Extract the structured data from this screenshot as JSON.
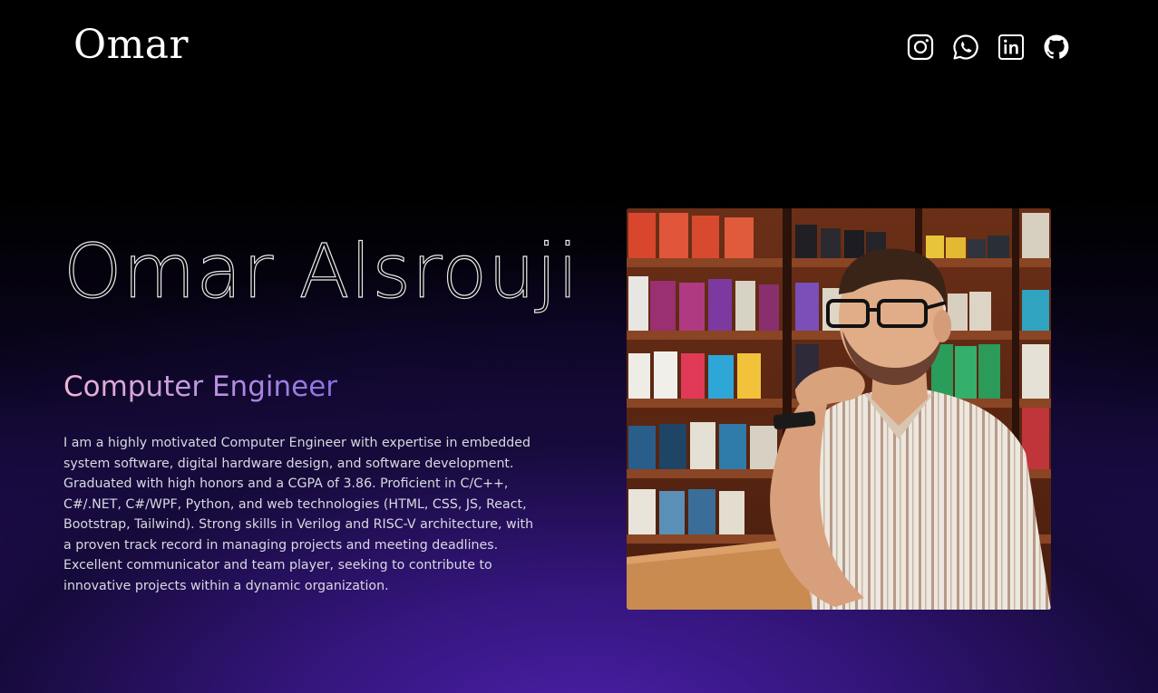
{
  "header": {
    "logo": "Omar",
    "socials": [
      {
        "icon": "instagram-icon"
      },
      {
        "icon": "whatsapp-icon"
      },
      {
        "icon": "linkedin-icon"
      },
      {
        "icon": "github-icon"
      }
    ]
  },
  "hero": {
    "name": "Omar Alsrouji",
    "role": "Computer Engineer",
    "bio": "I am a highly motivated Computer Engineer with expertise in embedded system software, digital hardware design, and software development. Graduated with high honors and a CGPA of 3.86. Proficient in C/C++, C#/.NET, C#/WPF, Python, and web technologies (HTML, CSS, JS, React, Bootstrap, Tailwind). Strong skills in Verilog and RISC-V architecture, with a proven track record in managing projects and meeting deadlines. Excellent communicator and team player, seeking to contribute to innovative projects within a dynamic organization."
  },
  "colors": {
    "background": "#000000",
    "accent_gradient_start": "#f0b4d4",
    "accent_gradient_end": "#8b6fe0",
    "glow": "#4a1fa8"
  }
}
